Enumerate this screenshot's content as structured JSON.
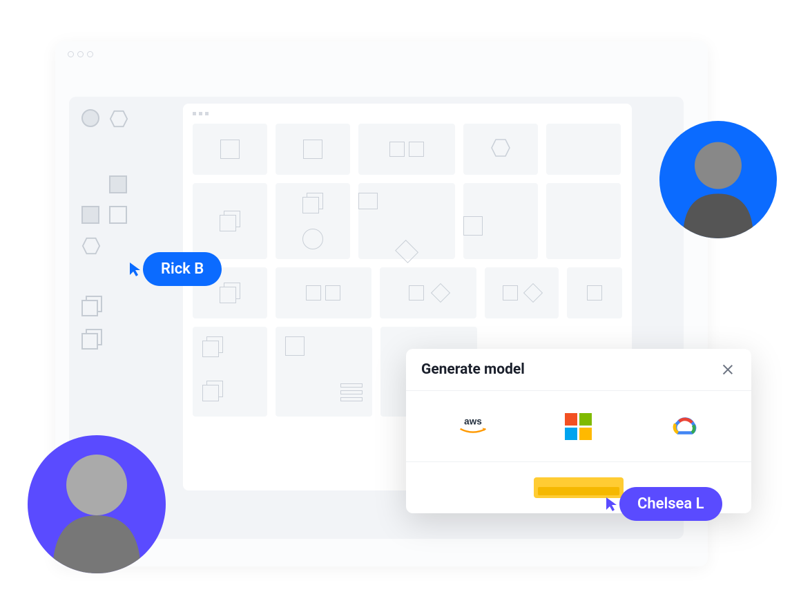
{
  "cursors": {
    "rick": {
      "label": "Rick B",
      "color": "#0b6bff"
    },
    "chelsea": {
      "label": "Chelsea L",
      "color": "#5a4bff"
    }
  },
  "modal": {
    "title": "Generate model",
    "providers": [
      "aws",
      "microsoft",
      "google-cloud"
    ],
    "button_label": ""
  }
}
